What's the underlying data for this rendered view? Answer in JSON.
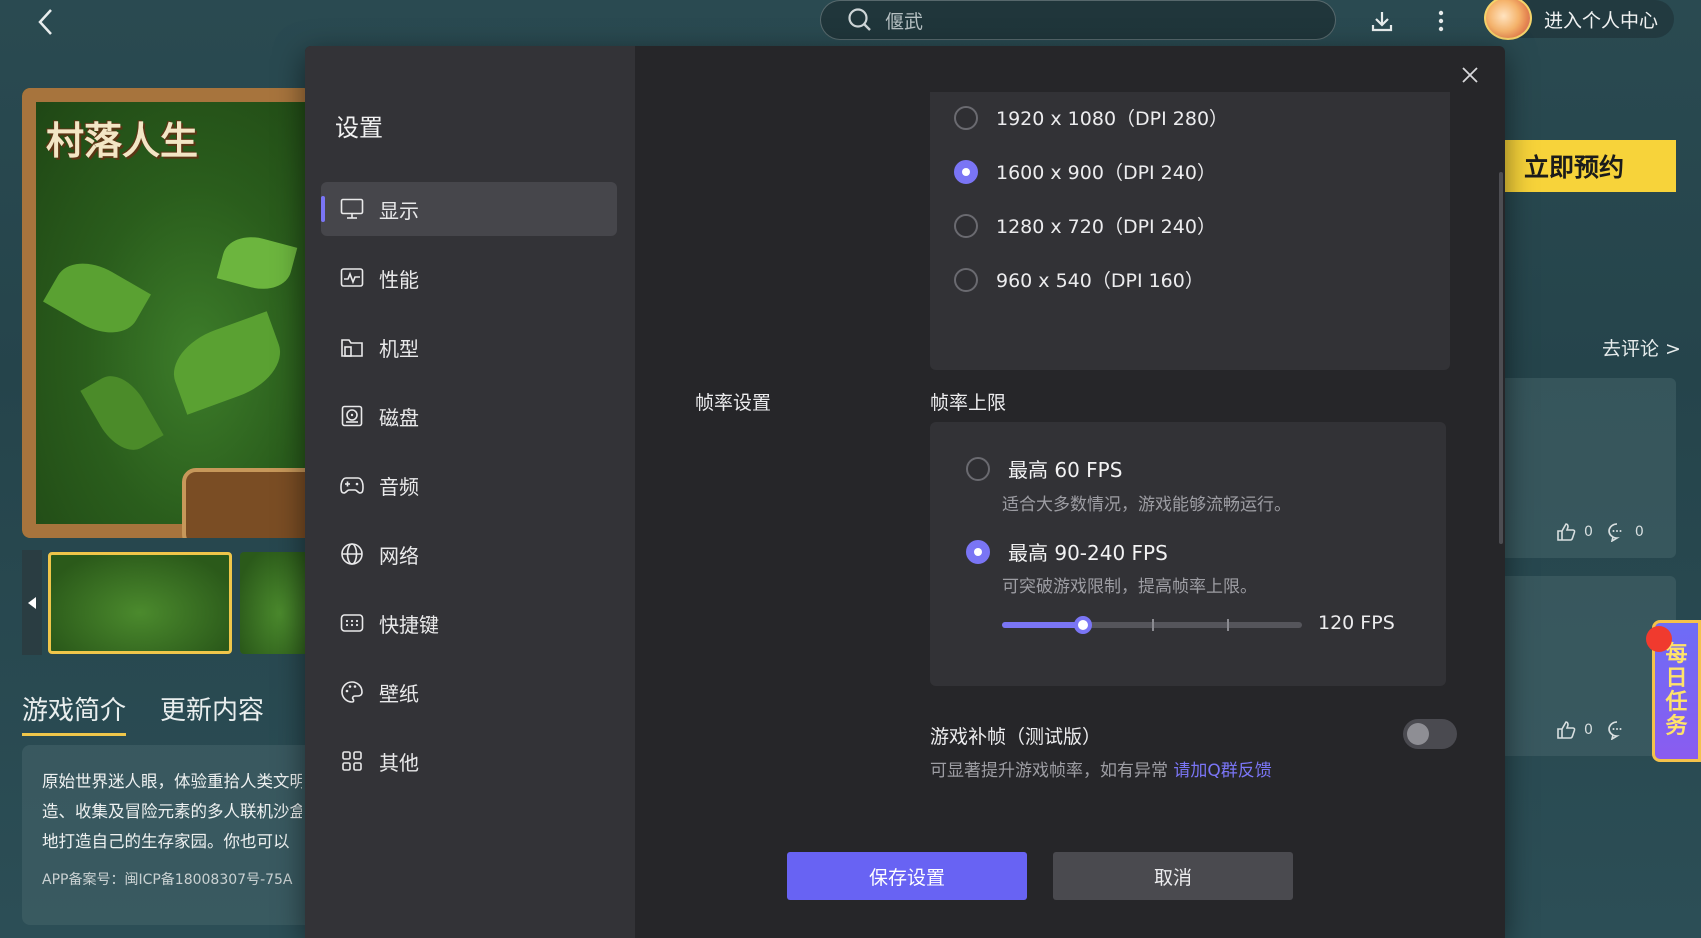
{
  "topbar": {
    "search_placeholder": "偃武",
    "user_center_label": "进入个人中心"
  },
  "game": {
    "logo_text": "村落人生",
    "tabs": [
      {
        "label": "游戏简介",
        "active": true
      },
      {
        "label": "更新内容",
        "active": false
      }
    ],
    "intro_lines": [
      "原始世界迷人眼，体验重拾人类文明",
      "造、收集及冒险元素的多人联机沙盒",
      "地打造自己的生存家园。你也可以"
    ],
    "icp": "APP备案号：闽ICP备18008307号-75A"
  },
  "right_panel": {
    "reserve_label": "立即预约",
    "go_review_label": "去评论 >",
    "comment_cards": [
      {
        "likes": "0",
        "comments": "0"
      },
      {
        "likes": "0",
        "comments": ""
      }
    ],
    "daily_task_chars": [
      "每",
      "日",
      "任",
      "务"
    ]
  },
  "settings": {
    "title": "设置",
    "nav": [
      {
        "label": "显示",
        "icon": "monitor-icon",
        "active": true
      },
      {
        "label": "性能",
        "icon": "performance-icon",
        "active": false
      },
      {
        "label": "机型",
        "icon": "device-model-icon",
        "active": false
      },
      {
        "label": "磁盘",
        "icon": "disk-icon",
        "active": false
      },
      {
        "label": "音频",
        "icon": "gamepad-icon",
        "active": false
      },
      {
        "label": "网络",
        "icon": "globe-icon",
        "active": false
      },
      {
        "label": "快捷键",
        "icon": "keyboard-icon",
        "active": false
      },
      {
        "label": "壁纸",
        "icon": "palette-icon",
        "active": false
      },
      {
        "label": "其他",
        "icon": "grid-icon",
        "active": false
      }
    ],
    "resolutions": [
      {
        "label": "1920 x 1080（DPI 280）",
        "selected": false
      },
      {
        "label": "1600 x 900（DPI 240）",
        "selected": true
      },
      {
        "label": "1280 x 720（DPI 240）",
        "selected": false
      },
      {
        "label": "960 x 540（DPI 160）",
        "selected": false
      }
    ],
    "framerate": {
      "section_label": "帧率设置",
      "sub_label": "帧率上限",
      "options": [
        {
          "title": "最高 60 FPS",
          "desc": "适合大多数情况，游戏能够流畅运行。",
          "selected": false
        },
        {
          "title": "最高 90-240 FPS",
          "desc": "可突破游戏限制，提高帧率上限。",
          "selected": true
        }
      ],
      "slider_value": "120 FPS",
      "slider_fraction": 0.27
    },
    "interpolation": {
      "title": "游戏补帧（测试版）",
      "desc": "可显著提升游戏帧率，如有异常",
      "link": "请加Q群反馈",
      "enabled": false
    },
    "buttons": {
      "save": "保存设置",
      "cancel": "取消"
    },
    "accent_color": "#6863f3"
  }
}
